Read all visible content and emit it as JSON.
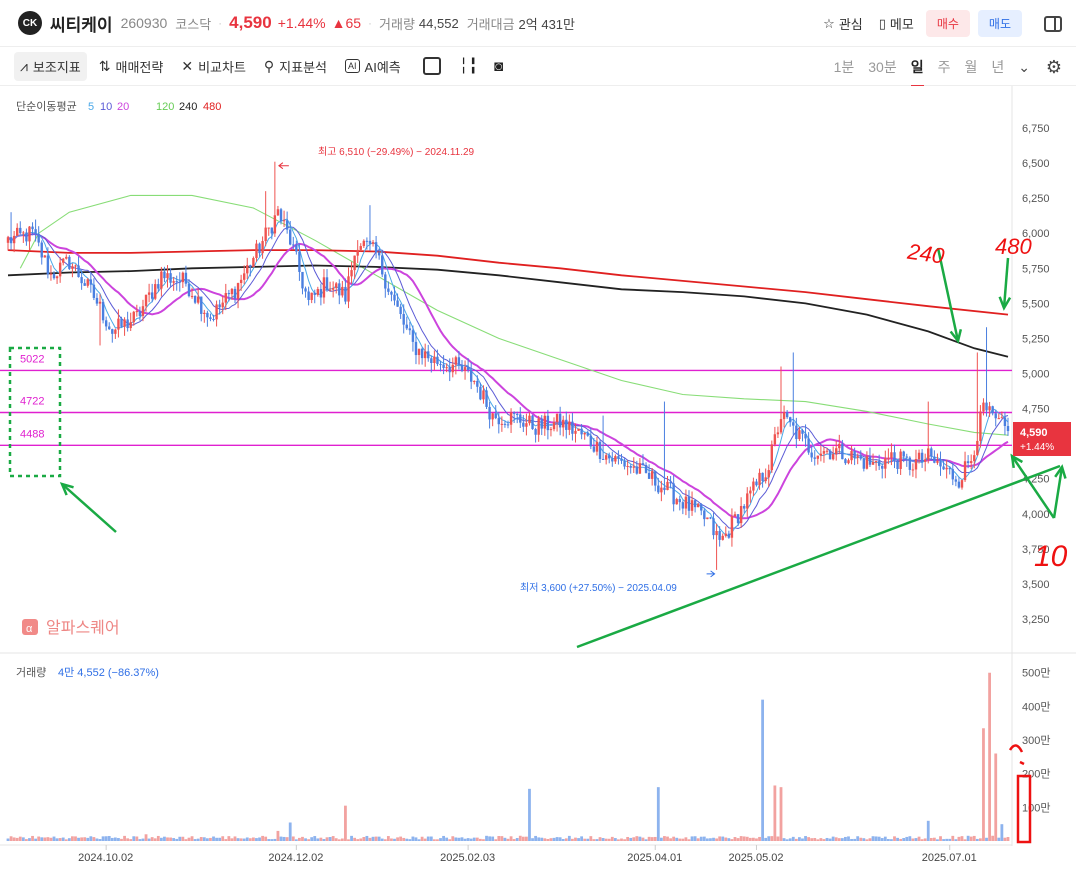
{
  "header": {
    "logo_text": "CK",
    "stock_name": "씨티케이",
    "code": "260930",
    "market": "코스닥",
    "price": "4,590",
    "change_rate": "+1.44%",
    "change": "▲65",
    "volume_label": "거래량",
    "volume_value": "44,552",
    "amount_label": "거래대금",
    "amount_value": "2억 431만",
    "favorite_label": "관심",
    "memo_label": "메모",
    "buy_label": "매수",
    "sell_label": "매도"
  },
  "toolbar": {
    "indicator_label": "보조지표",
    "strategy_label": "매매전략",
    "compare_label": "비교차트",
    "analysis_label": "지표분석",
    "ai_label": "AI예측",
    "periods": [
      "1분",
      "30분",
      "일",
      "주",
      "월",
      "년"
    ],
    "active_period": "일"
  },
  "colors": {
    "up": "#ef5350",
    "down": "#4a7fe0",
    "ma5": "#4aa8e8",
    "ma10": "#5b5bd6",
    "ma20": "#cc44dd",
    "ma120": "#88dd77",
    "ma240": "#222222",
    "ma480": "#e02020",
    "hline": "#e020d0",
    "annotation_green": "#1aaa44",
    "annotation_red": "#ee1111"
  },
  "chart_data": {
    "type": "candlestick",
    "legend": {
      "title": "단순이동평균",
      "periods": [
        "5",
        "10",
        "20",
        "120",
        "240",
        "480"
      ]
    },
    "y_ticks": [
      "6,750",
      "6,500",
      "6,250",
      "6,000",
      "5,750",
      "5,500",
      "5,250",
      "5,000",
      "4,750",
      "4,500",
      "4,250",
      "4,000",
      "3,750",
      "3,500",
      "3,250"
    ],
    "ylim": [
      3200,
      6850
    ],
    "x_ticks": [
      "2024.10.02",
      "2024.12.02",
      "2025.02.03",
      "2025.04.01",
      "2025.05.02",
      "2025.07.01"
    ],
    "price_path": [
      [
        0,
        5950
      ],
      [
        8,
        6000
      ],
      [
        14,
        5700
      ],
      [
        20,
        5800
      ],
      [
        28,
        5550
      ],
      [
        34,
        5300
      ],
      [
        42,
        5400
      ],
      [
        50,
        5700
      ],
      [
        58,
        5650
      ],
      [
        66,
        5400
      ],
      [
        74,
        5600
      ],
      [
        82,
        5900
      ],
      [
        88,
        6150
      ],
      [
        92,
        5950
      ],
      [
        98,
        5500
      ],
      [
        104,
        5650
      ],
      [
        110,
        5550
      ],
      [
        114,
        5950
      ],
      [
        120,
        5850
      ],
      [
        126,
        5500
      ],
      [
        132,
        5200
      ],
      [
        138,
        5100
      ],
      [
        146,
        5050
      ],
      [
        152,
        4950
      ],
      [
        158,
        4700
      ],
      [
        166,
        4680
      ],
      [
        172,
        4620
      ],
      [
        180,
        4650
      ],
      [
        188,
        4550
      ],
      [
        196,
        4400
      ],
      [
        202,
        4350
      ],
      [
        210,
        4250
      ],
      [
        216,
        4150
      ],
      [
        222,
        4050
      ],
      [
        228,
        3950
      ],
      [
        232,
        3800
      ],
      [
        234,
        3850
      ],
      [
        238,
        4000
      ],
      [
        244,
        4200
      ],
      [
        248,
        4350
      ],
      [
        252,
        4700
      ],
      [
        256,
        4600
      ],
      [
        262,
        4450
      ],
      [
        270,
        4450
      ],
      [
        276,
        4400
      ],
      [
        282,
        4350
      ],
      [
        288,
        4400
      ],
      [
        294,
        4350
      ],
      [
        300,
        4400
      ],
      [
        306,
        4300
      ],
      [
        310,
        4250
      ],
      [
        314,
        4400
      ],
      [
        318,
        4750
      ],
      [
        322,
        4650
      ],
      [
        326,
        4590
      ]
    ],
    "spikes": [
      [
        1,
        6150
      ],
      [
        30,
        5200
      ],
      [
        84,
        6300
      ],
      [
        87,
        6510
      ],
      [
        96,
        5700
      ],
      [
        118,
        6200
      ],
      [
        194,
        4700
      ],
      [
        214,
        4800
      ],
      [
        231,
        3600
      ],
      [
        252,
        5050
      ],
      [
        256,
        5150
      ],
      [
        300,
        4800
      ],
      [
        316,
        5150
      ],
      [
        319,
        5330
      ]
    ],
    "ma_series": [
      {
        "period": "120",
        "points": [
          [
            4,
            5750
          ],
          [
            10,
            6000
          ],
          [
            20,
            6150
          ],
          [
            40,
            6270
          ],
          [
            60,
            6270
          ],
          [
            80,
            6180
          ],
          [
            100,
            5950
          ],
          [
            120,
            5700
          ],
          [
            140,
            5450
          ],
          [
            160,
            5250
          ],
          [
            180,
            5100
          ],
          [
            200,
            4950
          ],
          [
            220,
            4850
          ],
          [
            240,
            4820
          ],
          [
            260,
            4800
          ],
          [
            280,
            4730
          ],
          [
            300,
            4640
          ],
          [
            315,
            4580
          ],
          [
            326,
            4560
          ]
        ]
      },
      {
        "period": "240",
        "points": [
          [
            0,
            5700
          ],
          [
            20,
            5720
          ],
          [
            40,
            5730
          ],
          [
            60,
            5750
          ],
          [
            80,
            5760
          ],
          [
            100,
            5770
          ],
          [
            120,
            5760
          ],
          [
            140,
            5740
          ],
          [
            160,
            5700
          ],
          [
            180,
            5650
          ],
          [
            200,
            5600
          ],
          [
            220,
            5580
          ],
          [
            240,
            5550
          ],
          [
            260,
            5500
          ],
          [
            280,
            5420
          ],
          [
            300,
            5300
          ],
          [
            315,
            5180
          ],
          [
            326,
            5120
          ]
        ]
      },
      {
        "period": "480",
        "points": [
          [
            0,
            5880
          ],
          [
            20,
            5860
          ],
          [
            40,
            5860
          ],
          [
            60,
            5870
          ],
          [
            80,
            5880
          ],
          [
            100,
            5880
          ],
          [
            120,
            5870
          ],
          [
            140,
            5840
          ],
          [
            160,
            5790
          ],
          [
            180,
            5750
          ],
          [
            200,
            5700
          ],
          [
            220,
            5660
          ],
          [
            240,
            5620
          ],
          [
            260,
            5580
          ],
          [
            280,
            5530
          ],
          [
            300,
            5480
          ],
          [
            326,
            5420
          ]
        ]
      }
    ],
    "high_annotation": "최고 6,510 (−29.49%) − 2024.11.29",
    "low_annotation": "최저 3,600 (+27.50%) − 2025.04.09",
    "high_point": [
      87,
      6510
    ],
    "low_point": [
      231,
      3600
    ],
    "horizontal_lines": [
      {
        "value": 5022,
        "label": "5022"
      },
      {
        "value": 4722,
        "label": "4722"
      },
      {
        "value": 4488,
        "label": "4488"
      }
    ],
    "current_price": {
      "label": "4,590",
      "rate": "+1.44%",
      "value": 4590
    },
    "handwritten_notes": [
      "240",
      "480",
      "10"
    ],
    "volume": {
      "legend_label": "거래량",
      "legend_value": "4만 4,552 (−86.37%)",
      "ticks": [
        "500만",
        "400만",
        "300만",
        "200만",
        "100만"
      ],
      "ylim": [
        0,
        5200000
      ],
      "bars": [
        [
          45,
          200000,
          "up"
        ],
        [
          88,
          300000,
          "up"
        ],
        [
          92,
          550000,
          "down"
        ],
        [
          110,
          1050000,
          "up"
        ],
        [
          170,
          1550000,
          "down"
        ],
        [
          212,
          1600000,
          "down"
        ],
        [
          246,
          4200000,
          "down"
        ],
        [
          250,
          1650000,
          "up"
        ],
        [
          252,
          1600000,
          "up"
        ],
        [
          300,
          600000,
          "down"
        ],
        [
          318,
          3350000,
          "up"
        ],
        [
          320,
          5000000,
          "up"
        ],
        [
          322,
          2600000,
          "up"
        ],
        [
          324,
          500000,
          "down"
        ]
      ],
      "base_volume": 120000
    },
    "watermark": "알파스퀘어"
  }
}
